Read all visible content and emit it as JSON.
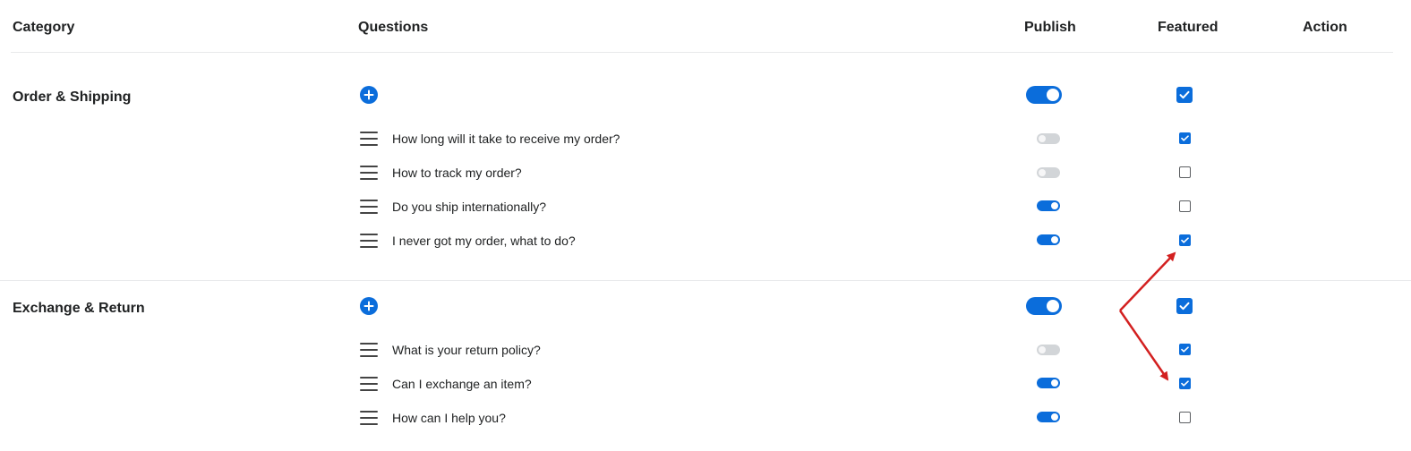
{
  "header": {
    "category": "Category",
    "questions": "Questions",
    "publish": "Publish",
    "featured": "Featured",
    "action": "Action"
  },
  "categories": [
    {
      "name": "Order & Shipping",
      "published": true,
      "featured": true,
      "add_icon": "plus-circle-icon",
      "questions": [
        {
          "text": "How long will it take to receive my order?",
          "published": false,
          "featured": true
        },
        {
          "text": "How to track my order?",
          "published": false,
          "featured": false
        },
        {
          "text": "Do you ship internationally?",
          "published": true,
          "featured": false
        },
        {
          "text": "I never got my order, what to do?",
          "published": true,
          "featured": true
        }
      ]
    },
    {
      "name": "Exchange & Return",
      "published": true,
      "featured": true,
      "add_icon": "plus-circle-icon",
      "questions": [
        {
          "text": "What is your return policy?",
          "published": false,
          "featured": true
        },
        {
          "text": "Can I exchange an item?",
          "published": true,
          "featured": true
        },
        {
          "text": "How can I help you?",
          "published": true,
          "featured": false
        }
      ]
    }
  ],
  "colors": {
    "accent": "#0b6ddb",
    "toggle_off": "#d2d5d8",
    "annotation_arrow": "#d32020"
  }
}
